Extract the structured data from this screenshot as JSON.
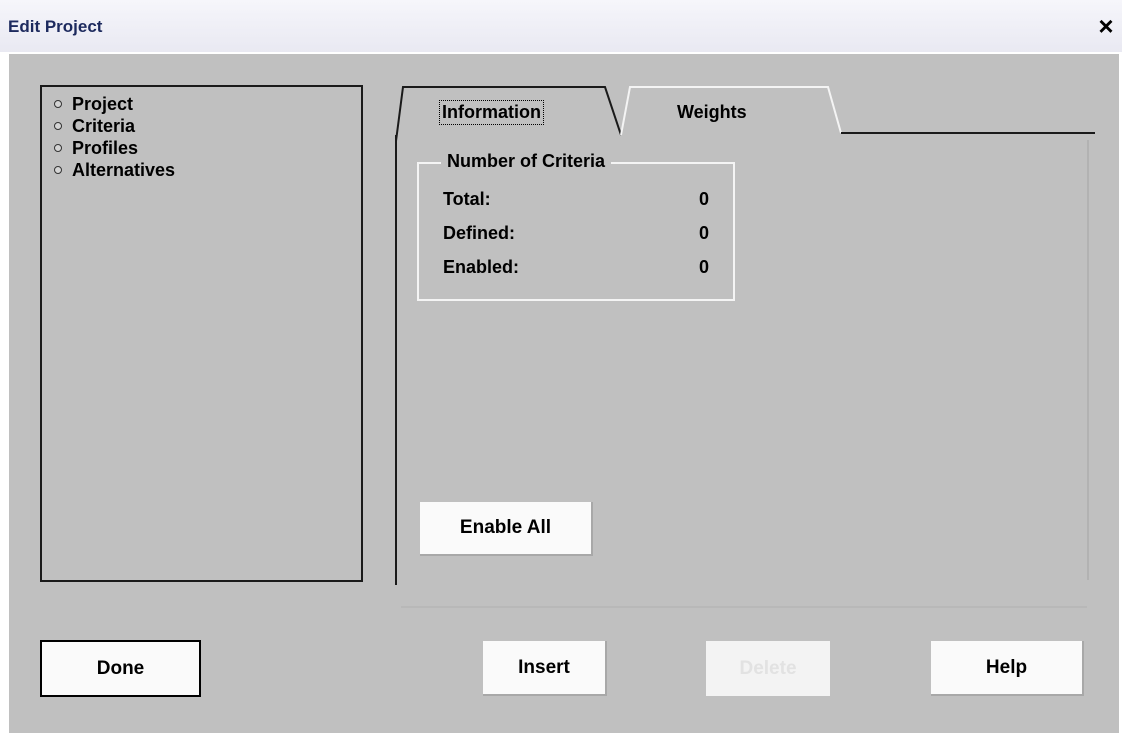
{
  "window": {
    "title": "Edit Project",
    "close_label": "×"
  },
  "tree": {
    "items": [
      {
        "label": "Project"
      },
      {
        "label": "Criteria"
      },
      {
        "label": "Profiles"
      },
      {
        "label": "Alternatives"
      }
    ]
  },
  "tabs": [
    {
      "label": "Information",
      "active": true
    },
    {
      "label": "Weights",
      "active": false
    }
  ],
  "criteria_group": {
    "legend": "Number of Criteria",
    "rows": [
      {
        "label": "Total:",
        "value": "0"
      },
      {
        "label": "Defined:",
        "value": "0"
      },
      {
        "label": "Enabled:",
        "value": "0"
      }
    ]
  },
  "buttons": {
    "enable_all": "Enable All",
    "done": "Done",
    "insert": "Insert",
    "delete": "Delete",
    "help": "Help"
  }
}
